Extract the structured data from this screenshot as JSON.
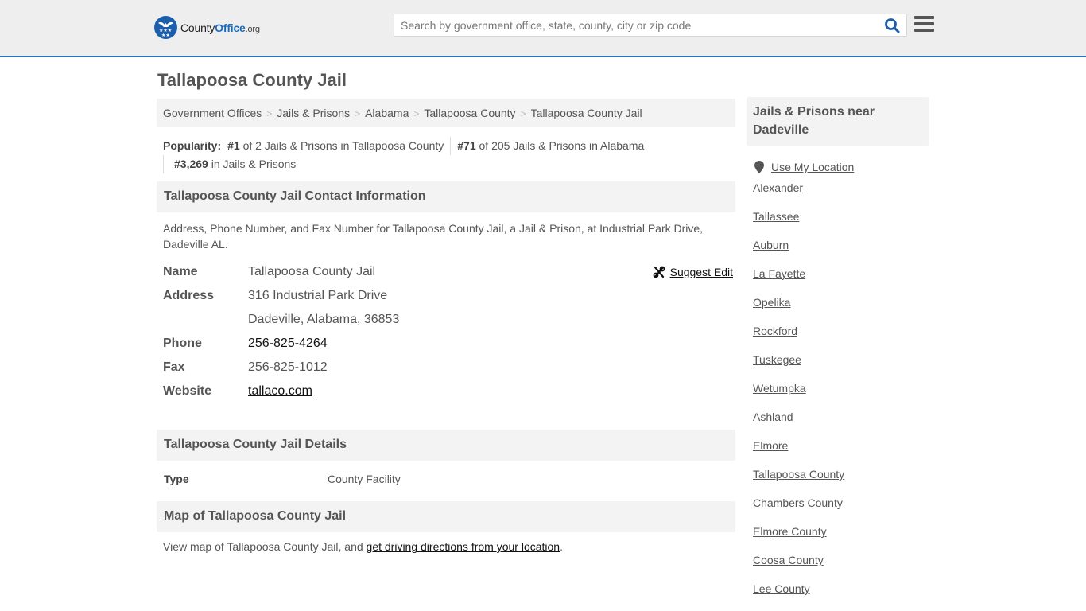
{
  "header": {
    "logo": {
      "county": "County",
      "office": "Office",
      "org": ".org"
    },
    "search_placeholder": "Search by government office, state, county, city or zip code",
    "search_value": "",
    "brand_color": "#1b5eab",
    "accent_color": "#2a72b5"
  },
  "page": {
    "title": "Tallapoosa County Jail"
  },
  "breadcrumb": [
    "Government Offices",
    "Jails & Prisons",
    "Alabama",
    "Tallapoosa County",
    "Tallapoosa County Jail"
  ],
  "popularity": {
    "label": "Popularity:",
    "items": [
      {
        "rank": "#1",
        "text": "of 2 Jails & Prisons in Tallapoosa County"
      },
      {
        "rank": "#71",
        "text": "of 205 Jails & Prisons in Alabama"
      },
      {
        "rank": "#3,269",
        "text": "in Jails & Prisons"
      }
    ]
  },
  "contact": {
    "heading": "Tallapoosa County Jail Contact Information",
    "description": "Address, Phone Number, and Fax Number for Tallapoosa County Jail, a Jail & Prison, at Industrial Park Drive, Dadeville AL.",
    "suggest_edit": "Suggest Edit",
    "rows": [
      {
        "label": "Name",
        "value": "Tallapoosa County Jail"
      },
      {
        "label": "Address",
        "value": "316 Industrial Park Drive"
      },
      {
        "label": "",
        "value": "Dadeville, Alabama, 36853"
      },
      {
        "label": "Phone",
        "value": "256-825-4264"
      },
      {
        "label": "Fax",
        "value": "256-825-1012"
      },
      {
        "label": "Website",
        "value": "tallaco.com"
      }
    ]
  },
  "details": {
    "heading": "Tallapoosa County Jail Details",
    "rows": [
      {
        "label": "Type",
        "value": "County Facility"
      }
    ]
  },
  "map": {
    "heading": "Map of Tallapoosa County Jail",
    "text": "View map of Tallapoosa County Jail, and ",
    "link": "get driving directions from your location",
    "end": "."
  },
  "sidebar": {
    "heading": "Jails & Prisons near Dadeville",
    "use_location": "Use My Location",
    "links": [
      "Alexander",
      "Tallassee",
      "Auburn",
      "La Fayette",
      "Opelika",
      "Rockford",
      "Tuskegee",
      "Wetumpka",
      "Ashland",
      "Elmore",
      "Tallapoosa County",
      "Chambers County",
      "Elmore County",
      "Coosa County",
      "Lee County"
    ]
  }
}
